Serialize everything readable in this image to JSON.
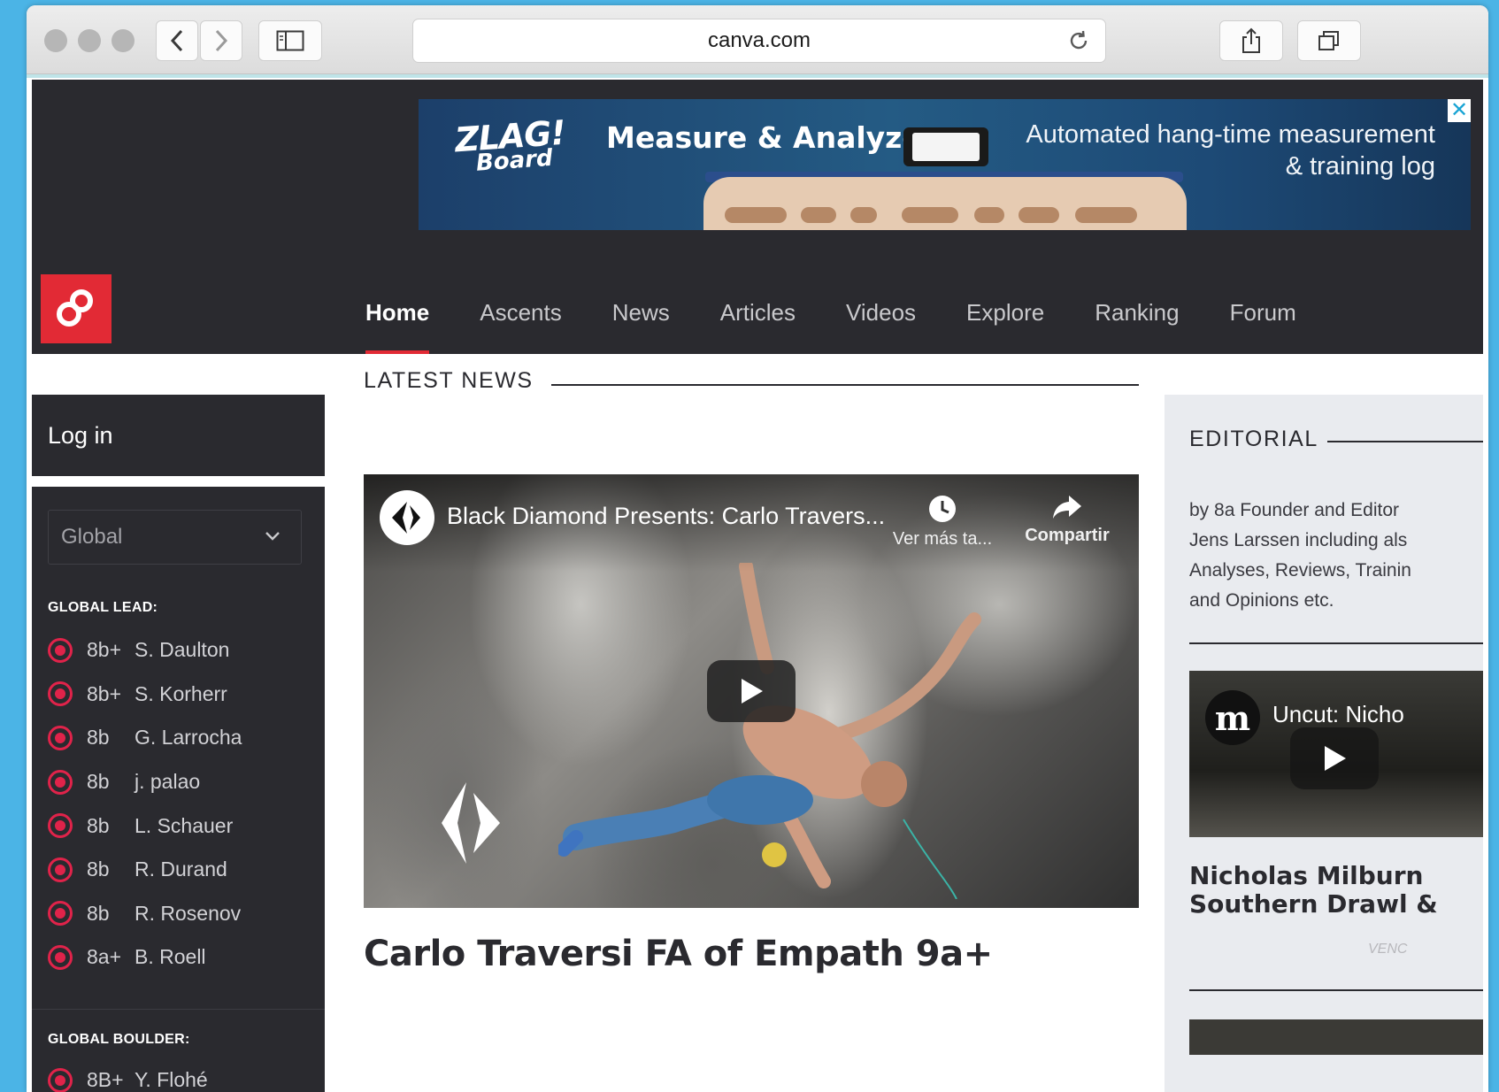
{
  "browser": {
    "url": "canva.com"
  },
  "ad": {
    "logo_line1": "ZLAG!",
    "logo_line2": "Board",
    "headline": "Measure & Analyze",
    "tagline_line1": "Automated hang-time measurement",
    "tagline_line2": "& training log",
    "close": "✕"
  },
  "nav": {
    "items": [
      {
        "label": "Home",
        "active": true
      },
      {
        "label": "Ascents"
      },
      {
        "label": "News"
      },
      {
        "label": "Articles"
      },
      {
        "label": "Videos"
      },
      {
        "label": "Explore"
      },
      {
        "label": "Ranking"
      },
      {
        "label": "Forum"
      }
    ]
  },
  "sidebar": {
    "login": "Log in",
    "region": "Global",
    "lead_title": "GLOBAL LEAD:",
    "lead": [
      {
        "grade": "8b+",
        "name": "S. Daulton"
      },
      {
        "grade": "8b+",
        "name": "S. Korherr"
      },
      {
        "grade": "8b",
        "name": "G. Larrocha"
      },
      {
        "grade": "8b",
        "name": "j. palao"
      },
      {
        "grade": "8b",
        "name": "L. Schauer"
      },
      {
        "grade": "8b",
        "name": "R. Durand"
      },
      {
        "grade": "8b",
        "name": "R. Rosenov"
      },
      {
        "grade": "8a+",
        "name": "B. Roell"
      }
    ],
    "boulder_title": "GLOBAL BOULDER:",
    "boulder": [
      {
        "grade": "8B+",
        "name": "Y. Flohé"
      }
    ]
  },
  "main": {
    "section_title": "LATEST NEWS",
    "video": {
      "title": "Black Diamond Presents: Carlo Travers...",
      "watch_later": "Ver más ta...",
      "share": "Compartir"
    },
    "headline": "Carlo Traversi FA of Empath 9a+"
  },
  "editorial": {
    "title": "EDITORIAL",
    "desc_line1": "by 8a Founder and Editor",
    "desc_line2": "Jens Larssen including als",
    "desc_line3": "Analyses, Reviews, Trainin",
    "desc_line4": "and Opinions etc.",
    "video_title": "Uncut: Nicho",
    "channel_glyph": "m",
    "article_line1": "Nicholas Milburn",
    "article_line2": "Southern Drawl &",
    "watermark": "VENC"
  },
  "colors": {
    "brand_red": "#e22a35",
    "dark_bg": "#2a2a2f",
    "radio": "#e0234a",
    "desktop": "#4bb4e6"
  }
}
